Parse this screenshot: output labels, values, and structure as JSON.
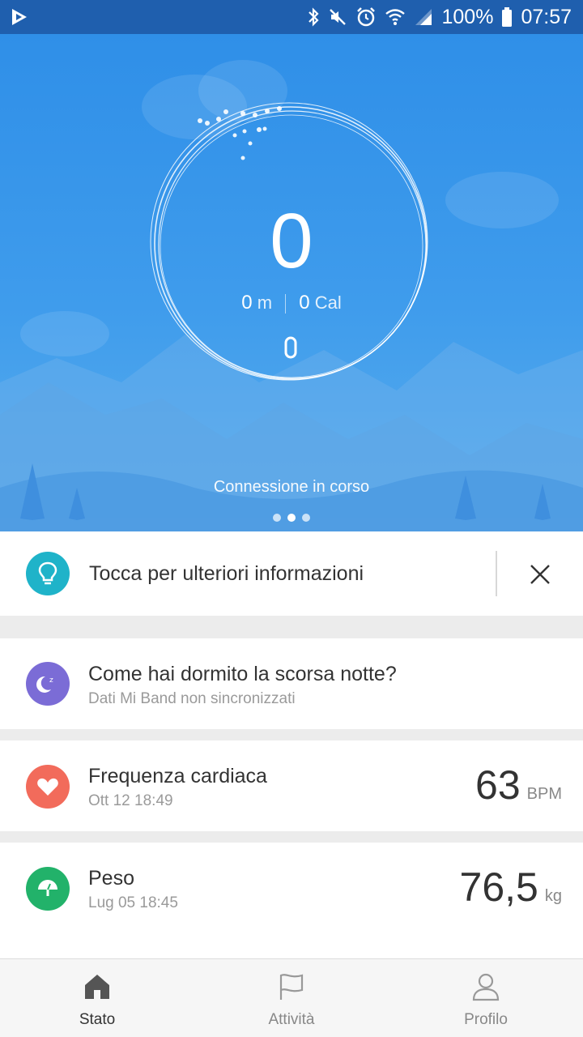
{
  "status_bar": {
    "battery": "100%",
    "time": "07:57",
    "icons": [
      "app-notification-icon",
      "bluetooth-icon",
      "mute-icon",
      "alarm-icon",
      "wifi-icon",
      "signal-icon",
      "battery-icon"
    ]
  },
  "hero": {
    "steps": "0",
    "distance_value": "0",
    "distance_unit": "m",
    "calories_value": "0",
    "calories_unit": "Cal",
    "status": "Connessione in corso",
    "page_count": 3,
    "active_page": 1
  },
  "tip_card": {
    "text": "Tocca per ulteriori informazioni",
    "icon": "lightbulb-icon",
    "color": "#1fb3c9"
  },
  "sleep_card": {
    "title": "Come hai dormito la scorsa notte?",
    "subtitle": "Dati Mi Band non sincronizzati",
    "icon": "moon-sleep-icon",
    "color": "#7b6cd6"
  },
  "heart_card": {
    "title": "Frequenza cardiaca",
    "subtitle": "Ott 12 18:49",
    "value": "63",
    "unit": "BPM",
    "icon": "heart-icon",
    "color": "#f26b5b"
  },
  "weight_card": {
    "title": "Peso",
    "subtitle": "Lug 05 18:45",
    "value": "76,5",
    "unit": "kg",
    "icon": "scale-icon",
    "color": "#22b26a"
  },
  "nav": {
    "items": [
      {
        "label": "Stato",
        "icon": "home-icon",
        "active": true
      },
      {
        "label": "Attività",
        "icon": "flag-icon",
        "active": false
      },
      {
        "label": "Profilo",
        "icon": "person-icon",
        "active": false
      }
    ]
  }
}
